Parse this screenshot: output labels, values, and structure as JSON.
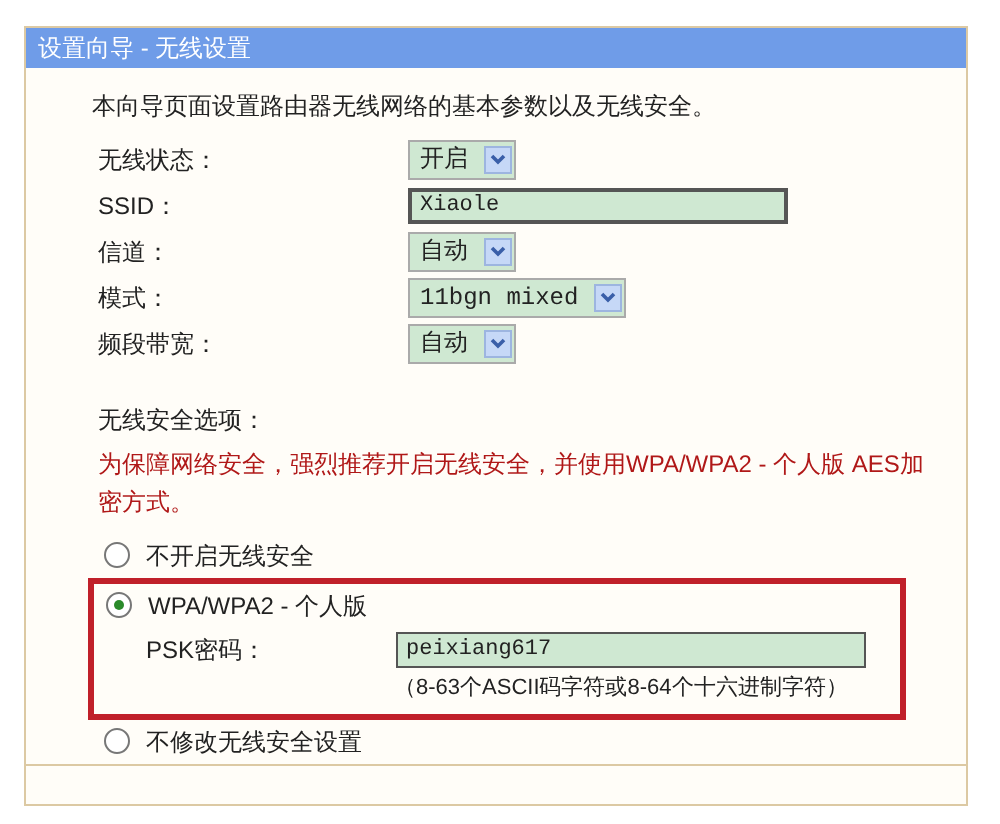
{
  "window": {
    "title": "设置向导 - 无线设置"
  },
  "intro": "本向导页面设置路由器无线网络的基本参数以及无线安全。",
  "fields": [
    {
      "kind": "select",
      "label": "无线状态：",
      "value": "开启"
    },
    {
      "kind": "text",
      "label": "SSID：",
      "value": "Xiaole"
    },
    {
      "kind": "select",
      "label": "信道：",
      "value": "自动"
    },
    {
      "kind": "select",
      "label": "模式：",
      "value": "11bgn mixed"
    },
    {
      "kind": "select",
      "label": "频段带宽：",
      "value": "自动"
    }
  ],
  "security": {
    "label": "无线安全选项：",
    "warning": "为保障网络安全，强烈推荐开启无线安全，并使用WPA/WPA2 - 个人版 AES加密方式。",
    "options": [
      {
        "label": "不开启无线安全",
        "selected": false
      },
      {
        "label": "WPA/WPA2 - 个人版",
        "selected": true,
        "psk": {
          "label": "PSK密码：",
          "value": "peixiang617",
          "hint": "（8-63个ASCII码字符或8-64个十六进制字符）"
        }
      },
      {
        "label": "不修改无线安全设置",
        "selected": false
      }
    ]
  }
}
